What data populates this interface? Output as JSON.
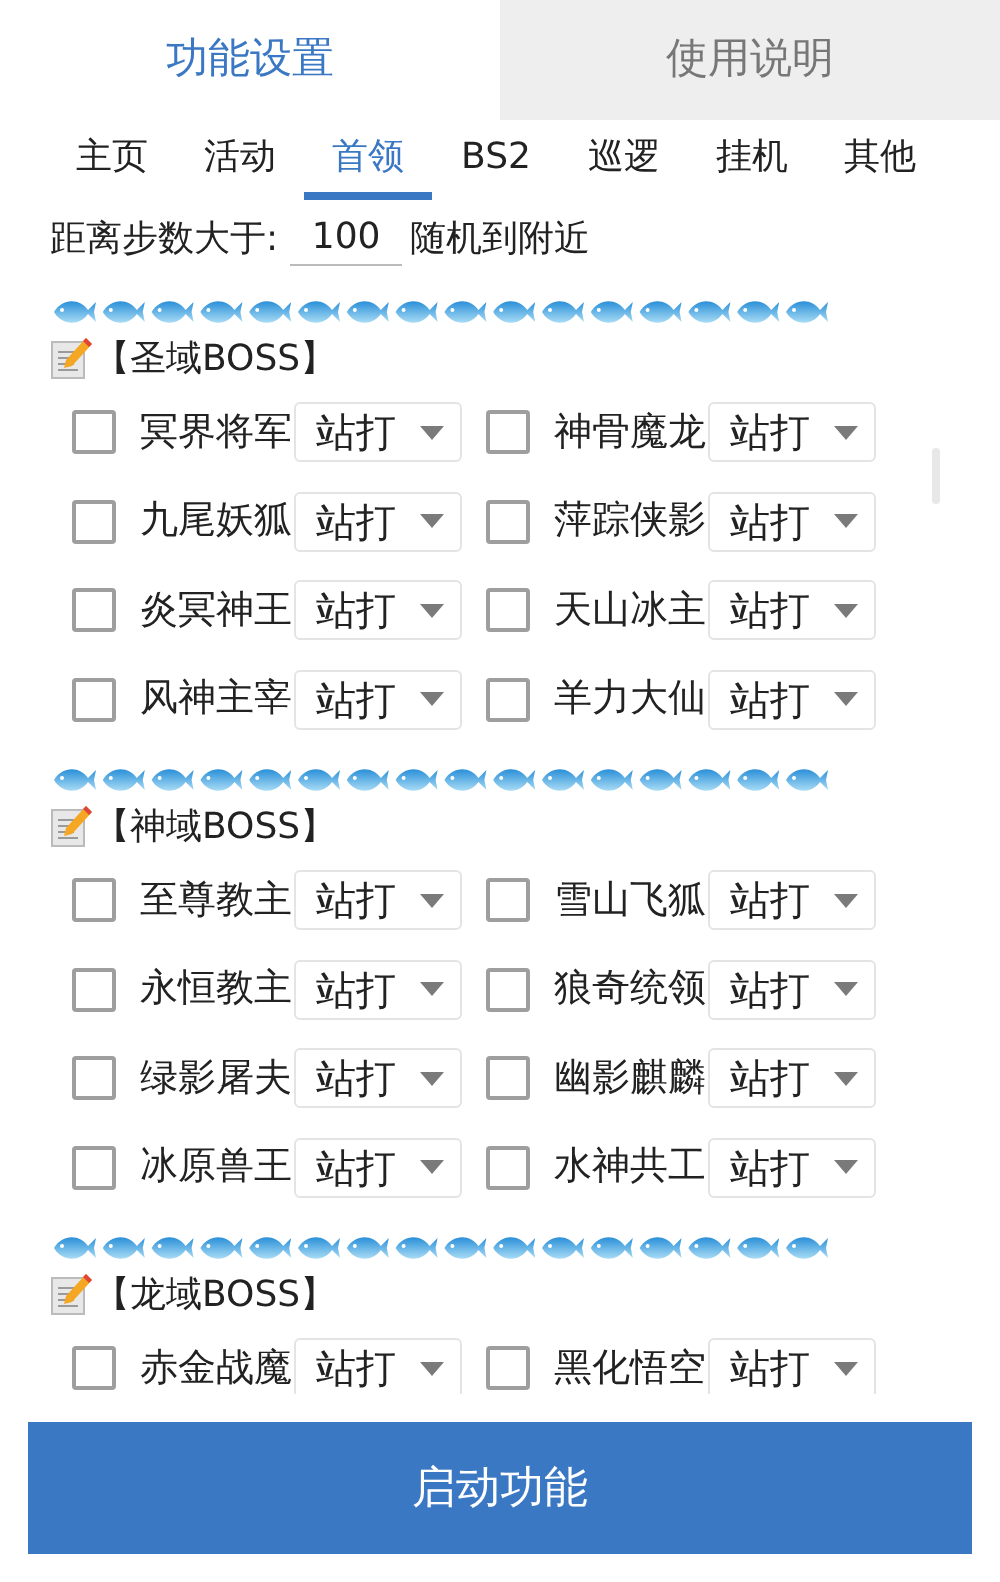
{
  "top_tabs": [
    {
      "label": "功能设置",
      "selected": true
    },
    {
      "label": "使用说明",
      "selected": false
    }
  ],
  "sub_tabs": [
    {
      "label": "主页",
      "selected": false
    },
    {
      "label": "活动",
      "selected": false
    },
    {
      "label": "首领",
      "selected": true
    },
    {
      "label": "BS2",
      "selected": false
    },
    {
      "label": "巡逻",
      "selected": false
    },
    {
      "label": "挂机",
      "selected": false
    },
    {
      "label": "其他",
      "selected": false
    }
  ],
  "distance": {
    "label": "距离步数大于:",
    "value": "100",
    "suffix": "随机到附近"
  },
  "sections": [
    {
      "title": "【圣域BOSS】",
      "bosses": [
        {
          "name": "冥界将军",
          "checked": false,
          "mode": "站打"
        },
        {
          "name": "神骨魔龙",
          "checked": false,
          "mode": "站打"
        },
        {
          "name": "九尾妖狐",
          "checked": false,
          "mode": "站打"
        },
        {
          "name": "萍踪侠影",
          "checked": false,
          "mode": "站打"
        },
        {
          "name": "炎冥神王",
          "checked": false,
          "mode": "站打"
        },
        {
          "name": "天山冰主",
          "checked": false,
          "mode": "站打"
        },
        {
          "name": "风神主宰",
          "checked": false,
          "mode": "站打"
        },
        {
          "name": "羊力大仙",
          "checked": false,
          "mode": "站打"
        }
      ]
    },
    {
      "title": "【神域BOSS】",
      "bosses": [
        {
          "name": "至尊教主",
          "checked": false,
          "mode": "站打"
        },
        {
          "name": "雪山飞狐",
          "checked": false,
          "mode": "站打"
        },
        {
          "name": "永恒教主",
          "checked": false,
          "mode": "站打"
        },
        {
          "name": "狼奇统领",
          "checked": false,
          "mode": "站打"
        },
        {
          "name": "绿影屠夫",
          "checked": false,
          "mode": "站打"
        },
        {
          "name": "幽影麒麟",
          "checked": false,
          "mode": "站打"
        },
        {
          "name": "冰原兽王",
          "checked": false,
          "mode": "站打"
        },
        {
          "name": "水神共工",
          "checked": false,
          "mode": "站打"
        }
      ]
    },
    {
      "title": "【龙域BOSS】",
      "bosses": [
        {
          "name": "赤金战魔",
          "checked": false,
          "mode": "站打"
        },
        {
          "name": "黑化悟空",
          "checked": false,
          "mode": "站打"
        }
      ]
    }
  ],
  "start_button": "启动功能"
}
